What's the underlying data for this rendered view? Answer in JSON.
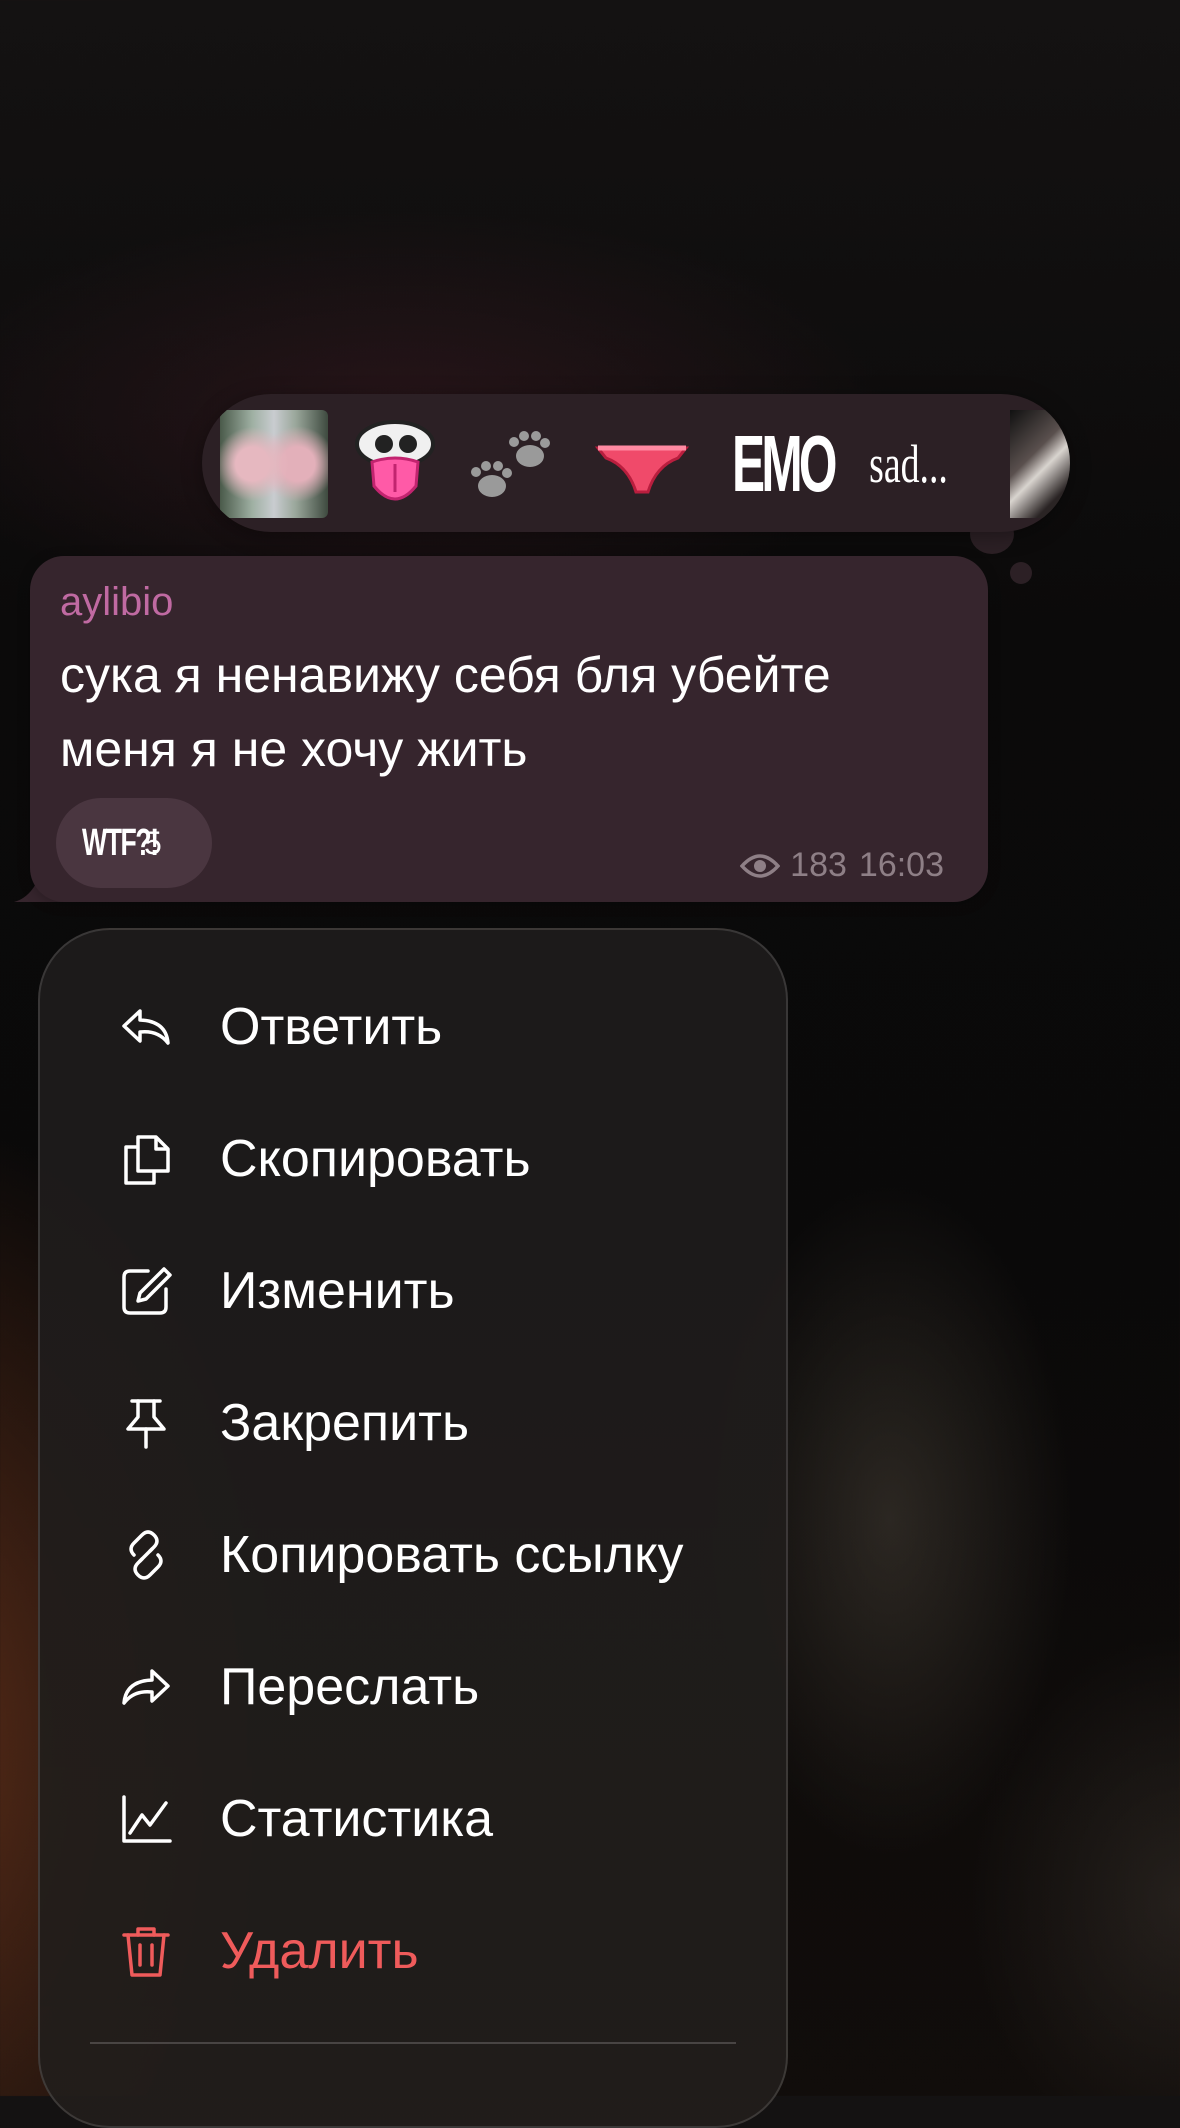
{
  "reactions_bar": {
    "items": [
      {
        "name": "photo-reaction-1"
      },
      {
        "name": "tongue-emoji"
      },
      {
        "name": "paw-prints-emoji"
      },
      {
        "name": "panties-emoji"
      },
      {
        "name": "emo-sticker",
        "text": "EMO"
      },
      {
        "name": "sad-sticker",
        "text": "sad..."
      },
      {
        "name": "photo-reaction-2"
      }
    ]
  },
  "message": {
    "sender": "aylibio",
    "text_line1": "сука я ненавижу себя бля убейте",
    "text_line2": "меня я не хочу жить",
    "reaction": {
      "label": "WTF?!",
      "count": "5"
    },
    "views": "183",
    "time": "16:03"
  },
  "menu": {
    "items": [
      {
        "label": "Ответить",
        "icon": "reply-icon"
      },
      {
        "label": "Скопировать",
        "icon": "copy-icon"
      },
      {
        "label": "Изменить",
        "icon": "edit-icon"
      },
      {
        "label": "Закрепить",
        "icon": "pin-icon"
      },
      {
        "label": "Копировать ссылку",
        "icon": "link-icon"
      },
      {
        "label": "Переслать",
        "icon": "forward-icon"
      },
      {
        "label": "Статистика",
        "icon": "stats-icon"
      },
      {
        "label": "Удалить",
        "icon": "trash-icon"
      }
    ]
  },
  "colors": {
    "sender": "#c06aa2",
    "bubble": "#36252d",
    "danger": "#ef5b5b"
  }
}
